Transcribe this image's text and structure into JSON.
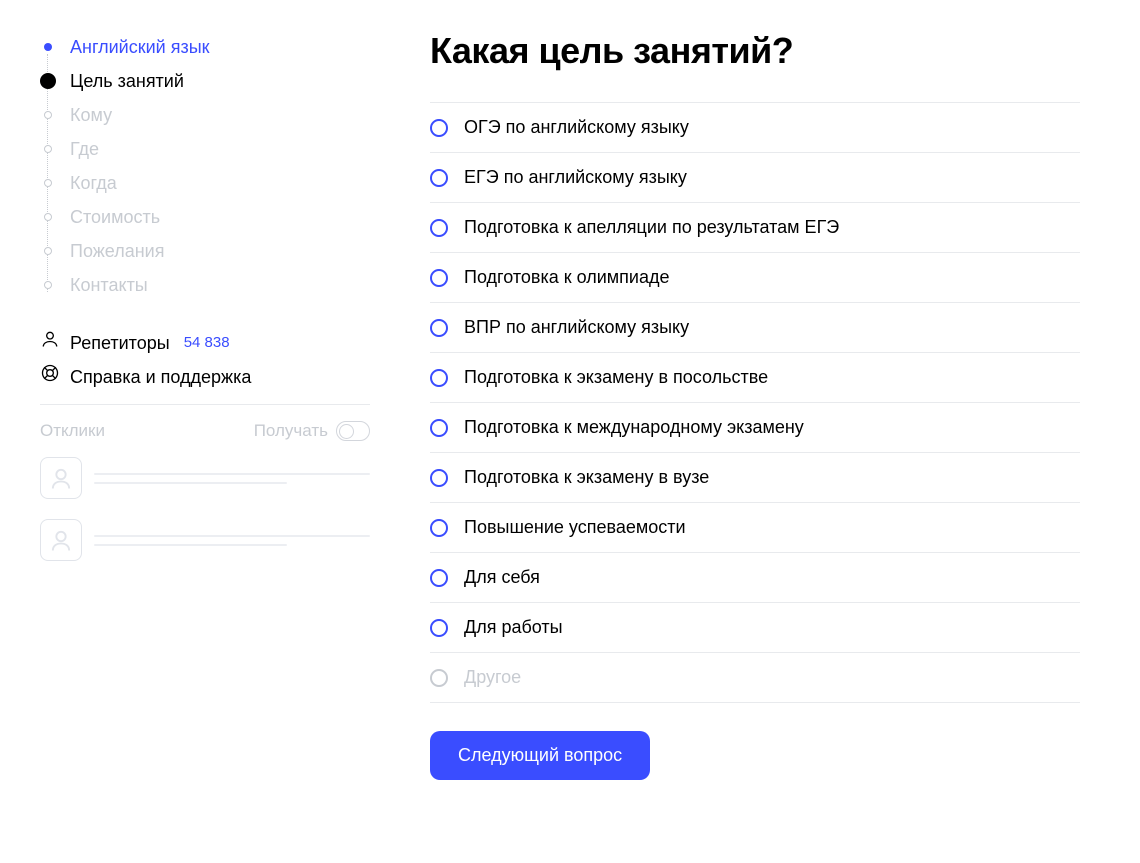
{
  "sidebar": {
    "steps": [
      {
        "label": "Английский язык",
        "state": "completed"
      },
      {
        "label": "Цель занятий",
        "state": "current"
      },
      {
        "label": "Кому",
        "state": "pending"
      },
      {
        "label": "Где",
        "state": "pending"
      },
      {
        "label": "Когда",
        "state": "pending"
      },
      {
        "label": "Стоимость",
        "state": "pending"
      },
      {
        "label": "Пожелания",
        "state": "pending"
      },
      {
        "label": "Контакты",
        "state": "pending"
      }
    ],
    "tutors_label": "Репетиторы",
    "tutors_count": "54 838",
    "help_label": "Справка и поддержка",
    "replies_label": "Отклики",
    "receive_label": "Получать"
  },
  "main": {
    "heading": "Какая цель занятий?",
    "options": [
      {
        "label": "ОГЭ по английскому языку",
        "muted": false
      },
      {
        "label": "ЕГЭ по английскому языку",
        "muted": false
      },
      {
        "label": "Подготовка к апелляции по результатам ЕГЭ",
        "muted": false
      },
      {
        "label": "Подготовка к олимпиаде",
        "muted": false
      },
      {
        "label": "ВПР по английскому языку",
        "muted": false
      },
      {
        "label": "Подготовка к экзамену в посольстве",
        "muted": false
      },
      {
        "label": "Подготовка к международному экзамену",
        "muted": false
      },
      {
        "label": "Подготовка к экзамену в вузе",
        "muted": false
      },
      {
        "label": "Повышение успеваемости",
        "muted": false
      },
      {
        "label": "Для себя",
        "muted": false
      },
      {
        "label": "Для работы",
        "muted": false
      },
      {
        "label": "Другое",
        "muted": true
      }
    ],
    "next_button": "Следующий вопрос"
  }
}
